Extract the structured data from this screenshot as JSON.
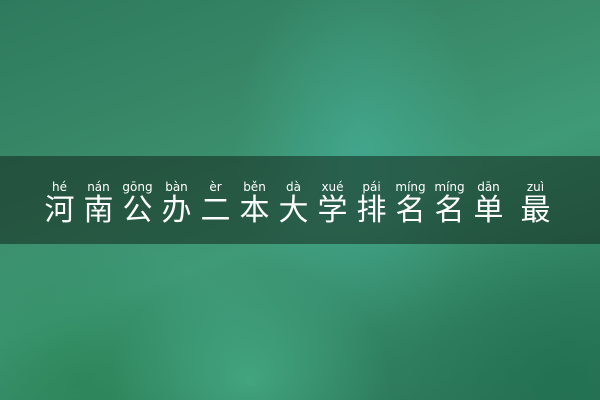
{
  "title": {
    "chars": [
      {
        "pinyin": "hé",
        "hanzi": "河"
      },
      {
        "pinyin": "nán",
        "hanzi": "南"
      },
      {
        "pinyin": "gōng",
        "hanzi": "公"
      },
      {
        "pinyin": "bàn",
        "hanzi": "办"
      },
      {
        "pinyin": "èr",
        "hanzi": "二"
      },
      {
        "pinyin": "běn",
        "hanzi": "本"
      },
      {
        "pinyin": "dà",
        "hanzi": "大"
      },
      {
        "pinyin": "xué",
        "hanzi": "学"
      },
      {
        "pinyin": "pái",
        "hanzi": "排"
      },
      {
        "pinyin": "míng",
        "hanzi": "名"
      },
      {
        "pinyin": "míng",
        "hanzi": "名"
      },
      {
        "pinyin": "dān",
        "hanzi": "单"
      },
      {
        "pinyin": "zuì",
        "hanzi": "最"
      }
    ]
  },
  "colors": {
    "text": "#ffffff",
    "band": "#142820",
    "background": "#3a8c6a"
  }
}
